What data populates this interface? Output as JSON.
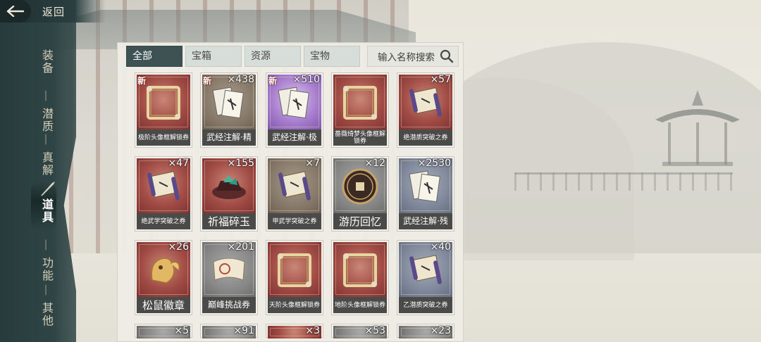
{
  "header": {
    "back_label": "返回"
  },
  "nav": {
    "items": [
      {
        "label": "装备",
        "active": false
      },
      {
        "label": "潜质",
        "active": false
      },
      {
        "label": "真解",
        "active": false
      },
      {
        "label": "道具",
        "active": true
      },
      {
        "label": "功能",
        "active": false
      },
      {
        "label": "其他",
        "active": false
      }
    ]
  },
  "inventory": {
    "tabs": [
      {
        "label": "全部",
        "active": true
      },
      {
        "label": "宝箱",
        "active": false
      },
      {
        "label": "资源",
        "active": false
      },
      {
        "label": "宝物",
        "active": false
      }
    ],
    "search": {
      "placeholder": "输入名称搜索"
    },
    "new_badge": "新",
    "items": [
      {
        "name": "极阶头像框解锁券",
        "count": "",
        "new": true,
        "rarity": "red",
        "icon": "frame-icon",
        "label_size": "small"
      },
      {
        "name": "武经注解·精",
        "count": "×438",
        "new": true,
        "rarity": "brown",
        "icon": "scroll-book-icon",
        "label_size": "normal"
      },
      {
        "name": "武经注解·极",
        "count": "×510",
        "new": true,
        "rarity": "purple",
        "icon": "scroll-book-icon",
        "label_size": "normal"
      },
      {
        "name": "蔷薇绮梦头像框解锁券",
        "count": "",
        "new": false,
        "rarity": "red",
        "icon": "frame-icon",
        "label_size": "small"
      },
      {
        "name": "绝潜质突破之券",
        "count": "×57",
        "new": false,
        "rarity": "red",
        "icon": "scroll-icon",
        "label_size": "small"
      },
      {
        "name": "绝武学突破之券",
        "count": "×47",
        "new": false,
        "rarity": "red",
        "icon": "scroll-icon",
        "label_size": "small"
      },
      {
        "name": "祈福碎玉",
        "count": "×155",
        "new": false,
        "rarity": "red",
        "icon": "jade-icon",
        "label_size": "big"
      },
      {
        "name": "甲武学突破之券",
        "count": "×7",
        "new": false,
        "rarity": "brown",
        "icon": "scroll-icon",
        "label_size": "small"
      },
      {
        "name": "游历回忆",
        "count": "×12",
        "new": false,
        "rarity": "grey",
        "icon": "coin-icon",
        "label_size": "big"
      },
      {
        "name": "武经注解·残",
        "count": "×2530",
        "new": false,
        "rarity": "slate",
        "icon": "scroll-book-icon",
        "label_size": "normal"
      },
      {
        "name": "松鼠徽章",
        "count": "×26",
        "new": false,
        "rarity": "red",
        "icon": "squirrel-icon",
        "label_size": "big"
      },
      {
        "name": "巅峰挑战券",
        "count": "×201",
        "new": false,
        "rarity": "grey",
        "icon": "ticket-icon",
        "label_size": "normal"
      },
      {
        "name": "天阶头像框解锁券",
        "count": "",
        "new": false,
        "rarity": "red",
        "icon": "frame-icon",
        "label_size": "small"
      },
      {
        "name": "地阶头像框解锁券",
        "count": "",
        "new": false,
        "rarity": "red",
        "icon": "frame-icon",
        "label_size": "small"
      },
      {
        "name": "乙潜质突破之券",
        "count": "×40",
        "new": false,
        "rarity": "slate",
        "icon": "scroll-icon",
        "label_size": "small"
      },
      {
        "name": "",
        "count": "×5",
        "new": false,
        "rarity": "grey",
        "icon": "",
        "label_size": "normal",
        "partial": true
      },
      {
        "name": "",
        "count": "×91",
        "new": false,
        "rarity": "grey",
        "icon": "",
        "label_size": "normal",
        "partial": true
      },
      {
        "name": "",
        "count": "×3",
        "new": false,
        "rarity": "red",
        "icon": "",
        "label_size": "normal",
        "partial": true
      },
      {
        "name": "",
        "count": "×53",
        "new": false,
        "rarity": "grey",
        "icon": "",
        "label_size": "normal",
        "partial": true
      },
      {
        "name": "",
        "count": "×23",
        "new": false,
        "rarity": "grey",
        "icon": "",
        "label_size": "normal",
        "partial": true
      }
    ]
  }
}
